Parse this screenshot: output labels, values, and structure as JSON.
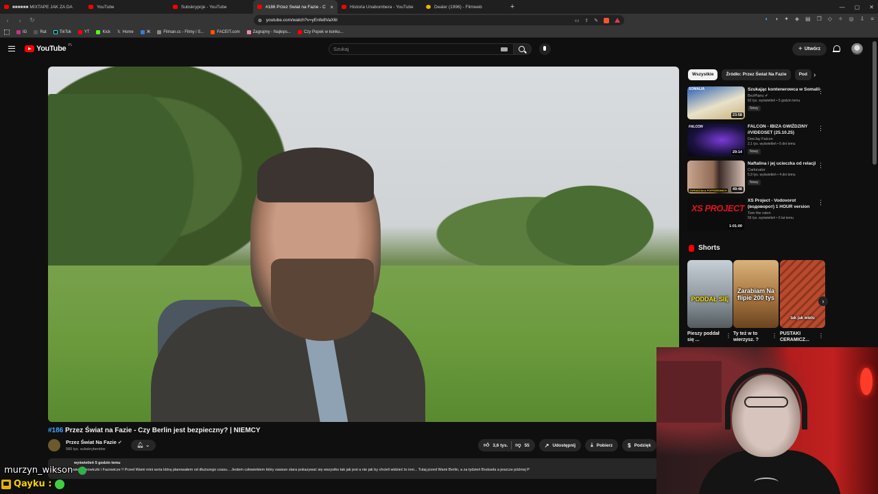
{
  "browser": {
    "tabs": [
      {
        "label": "■■■■■■ MIXTAPE JAK ZA DA",
        "icon": "youtube-favicon",
        "active": false
      },
      {
        "label": "YouTube",
        "icon": "youtube-favicon",
        "active": false
      },
      {
        "label": "Subskrypcje - YouTube",
        "icon": "youtube-favicon",
        "active": false
      },
      {
        "label": "#186 Przez Świat na Fazie - C",
        "icon": "youtube-favicon",
        "active": true
      },
      {
        "label": "Historia Unabombera - YouTube",
        "icon": "youtube-favicon",
        "active": false
      },
      {
        "label": "Dealer (1996) - Filmweb",
        "icon": "filmweb-favicon",
        "active": false
      }
    ],
    "new_tab": "+",
    "url": "youtube.com/watch?v=yEnfe8VaX6I",
    "bookmarks": [
      "IG",
      "Rat",
      "TikTok",
      "YT",
      "Kick",
      "Home",
      "Filman.cc - Filmy i S...",
      "FACEIT.com",
      "Zagrajmy - Najleps...",
      "Czy Popek w konku..."
    ]
  },
  "youtube": {
    "logo_text": "YouTube",
    "country_code": "PL",
    "search_placeholder": "Szukaj",
    "create_label": "Utwórz",
    "video": {
      "hashtag": "#186",
      "title": "Przez Świat na Fazie - Czy Berlin jest bezpieczny? | NIEMCY",
      "channel_name": "Przez Świat Na Fazie",
      "subscribers": "580 tys. subskrybentów",
      "likes": "3,6 tys.",
      "dislikes": "55",
      "share_label": "Udostępnij",
      "download_label": "Pobierz",
      "thanks_label": "Podzięk",
      "desc_meta": "wyświetleń  5 godzin temu",
      "desc_text": "Panie i Panowie, Fazowiczki i Fazowicze !! Przed Wami mini seria którą planowałem od dłuższego czasu... Jestem człowiekiem który zawsze stara pokazywać się wszystko tak jak jest a nie jak by chcieli widzieć to inni... Tutaj przed Wami Berlin, a za tydzień Bruksela a jeszcze później P"
    },
    "chips": [
      "Wszystkie",
      "Źródło: Przez Świat Na Fazie",
      "Pod"
    ],
    "recommendations": [
      {
        "title": "Szukając kontenerowca w Somalii",
        "channel": "BezPlanu",
        "stats": "62 tys. wyświetleń • 5 godzin temu",
        "badge": "Nowy",
        "duration": "23:58",
        "thumb_text": "SOMALIA"
      },
      {
        "title": "FALCON - IBIZA GWIŹDZINY //VIDEOSET (25.10.25)",
        "channel": "DeeJay Falcon",
        "stats": "2,1 tys. wyświetleń • 6 dni temu",
        "badge": "Nowy",
        "duration": "29:14",
        "thumb_text": "FALCON"
      },
      {
        "title": "Naftalina i jej ucieczka od relacji",
        "channel": "Carlonator",
        "stats": "5,9 tys. wyświetleń • 4 dni temu",
        "badge": "Nowy",
        "duration": "49:48",
        "thumb_text": "ZDRADZAŁA POPRZEDNICH"
      },
      {
        "title": "XS Project - Vodovorot (водоворот) 1 HOUR version",
        "channel": "Tom the raton",
        "stats": "56 tys. wyświetleń • 6 lat temu",
        "badge": "",
        "duration": "1:01:00",
        "thumb_text": "XS PROJECT"
      }
    ],
    "shorts_heading": "Shorts",
    "shorts": [
      {
        "title": "Pieszy poddał się ...",
        "overlay": "PODDAŁ SIĘ"
      },
      {
        "title": "Ty też w to wierzysz. ?",
        "overlay": "Zarabiam Na flipie 200 tys"
      },
      {
        "title": "PUSTAKI CERAMICZ...",
        "overlay": "tak jak wielu"
      }
    ]
  },
  "chat": {
    "user1": "murzyn_wikson",
    "user2": "Qayku :"
  },
  "colors": {
    "accent": "#ff0000",
    "link": "#3ea6ff",
    "chat_name2": "#f5d000"
  }
}
